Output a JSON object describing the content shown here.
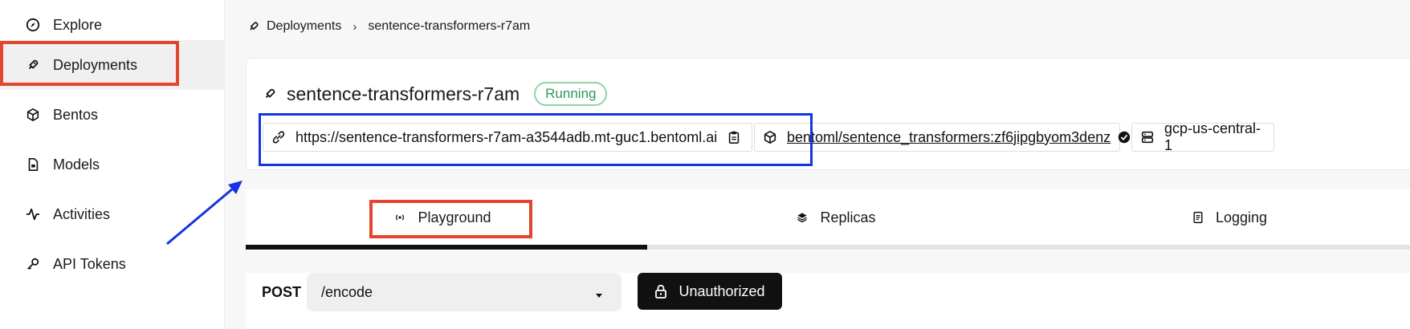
{
  "sidebar": {
    "items": [
      {
        "label": "Explore",
        "icon": "compass-icon"
      },
      {
        "label": "Deployments",
        "icon": "rocket-icon",
        "active": true
      },
      {
        "label": "Bentos",
        "icon": "box-icon"
      },
      {
        "label": "Models",
        "icon": "file-icon"
      },
      {
        "label": "Activities",
        "icon": "activity-icon"
      },
      {
        "label": "API Tokens",
        "icon": "key-icon"
      }
    ]
  },
  "breadcrumb": {
    "parent": "Deployments",
    "separator": "›",
    "current": "sentence-transformers-r7am"
  },
  "deployment": {
    "name": "sentence-transformers-r7am",
    "status": "Running",
    "url": "https://sentence-transformers-r7am-a3544adb.mt-guc1.bentoml.ai",
    "bento": "bentoml/sentence_transformers:zf6jipgbyom3denz",
    "cluster": "gcp-us-central-1"
  },
  "tabs": [
    {
      "label": "Playground",
      "icon": "radio-icon",
      "active": true
    },
    {
      "label": "Replicas",
      "icon": "layers-icon"
    },
    {
      "label": "Logging",
      "icon": "document-icon"
    }
  ],
  "request": {
    "method": "POST",
    "path": "/encode",
    "auth_label": "Unauthorized"
  },
  "colors": {
    "highlight_red": "#e2462e",
    "highlight_blue": "#1334e0",
    "status_green": "#2c9a5a"
  }
}
